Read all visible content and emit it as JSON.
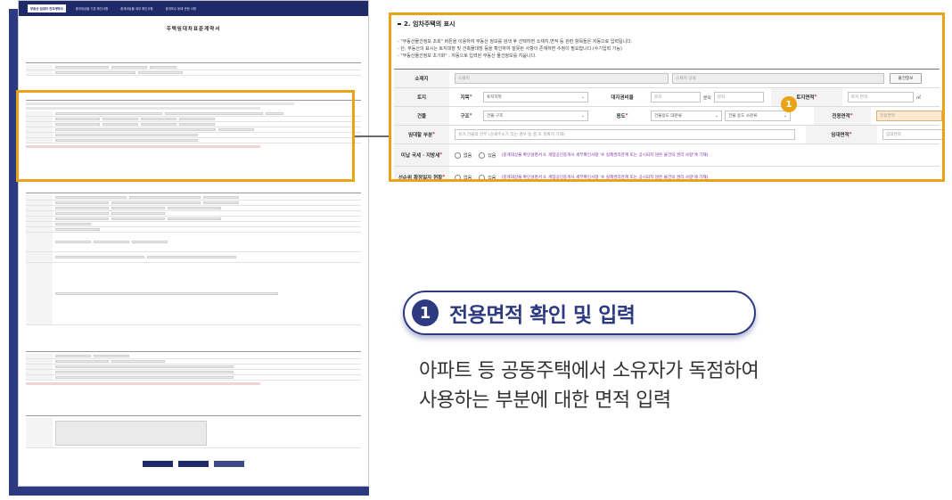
{
  "thumbnail": {
    "nav_tabs": [
      "부동산 임대차 전자계약서",
      "중개대상물 기본 확인사항",
      "중개대상물 세부 확인사항",
      "중개보수 등에 관한 사항"
    ],
    "title": "주택임대차표준계약서"
  },
  "zoom": {
    "section_title": "2. 임차주택의 표시",
    "notes": [
      "- \"부동산물건정보 조회\" 버튼을 이용하여 부동산 정보를 검색 후 선택하면 소재지,면적 등 관련 항목들은 자동으로 입력됩니다.",
      "- 단, 부동산의 표시는 토지대장 및 건축물대장 등을 확인하여 잘못된 사항이 존재하면 수정이 필요합니다.(수기입력 가능)",
      "- \"부동산물건정보 초기화\" : 자동으로 입력된 부동산 물건정보를 지웁니다."
    ],
    "address": {
      "label": "소재지",
      "placeholder": "소재지",
      "detail_placeholder": "소재지 상세",
      "button": "물건정보"
    },
    "land": {
      "label": "토지",
      "category_label": "지목",
      "category_value": "토지지목",
      "ratio_label": "대지권비율",
      "numerator_placeholder": "분모",
      "ratio_mid": "분의",
      "denominator_placeholder": "분자",
      "area_label": "토지면적",
      "area_placeholder": "토지 면적",
      "unit": "㎡"
    },
    "building": {
      "label": "건물",
      "structure_label": "구조",
      "structure_value": "건물 구조",
      "use_label": "용도",
      "use_major": "건물용도 대분류",
      "use_minor": "건물 용도 소분류",
      "area_label": "전용면적",
      "area_placeholder": "전용면적",
      "unit": "㎡",
      "marker": "1"
    },
    "rented": {
      "label": "임대할 부분",
      "placeholder": "실거 건물의 전부 (상세주소가 있는 경우 동·층·호 정확히 기재)",
      "area_label": "임대면적",
      "area_placeholder": "임대면적",
      "unit": "㎡"
    },
    "unpaid_tax": {
      "label": "미납 국세 · 지방세",
      "options": [
        "없음",
        "있음"
      ],
      "note": "(중개대상물 확인설명서 II. 개업공인중개사 세부확인사항 '⑨ 실제권리관계 또는 공시되지 않은 물건의 권리 사항'에 기재)"
    },
    "priority_date": {
      "label": "선순위 확정일자 현황",
      "options": [
        "없음",
        "있음"
      ],
      "note": "(중개대상물 확인설명서 II. 개업공인중개사 세부확인사항 '⑨ 실제권리관계 또는 공시되지 않은 물건의 권리 사항'에 기재)"
    }
  },
  "callout": {
    "number": "1",
    "title": "전용면적 확인 및 입력",
    "description_line1": "아파트 등 공동주택에서 소유자가 독점하여",
    "description_line2": "사용하는 부분에 대한 면적 입력"
  },
  "colors": {
    "navy": "#2d3a82",
    "highlight": "#e8a317",
    "required": "#d12b2b",
    "note_purple": "#7a2fa6"
  }
}
